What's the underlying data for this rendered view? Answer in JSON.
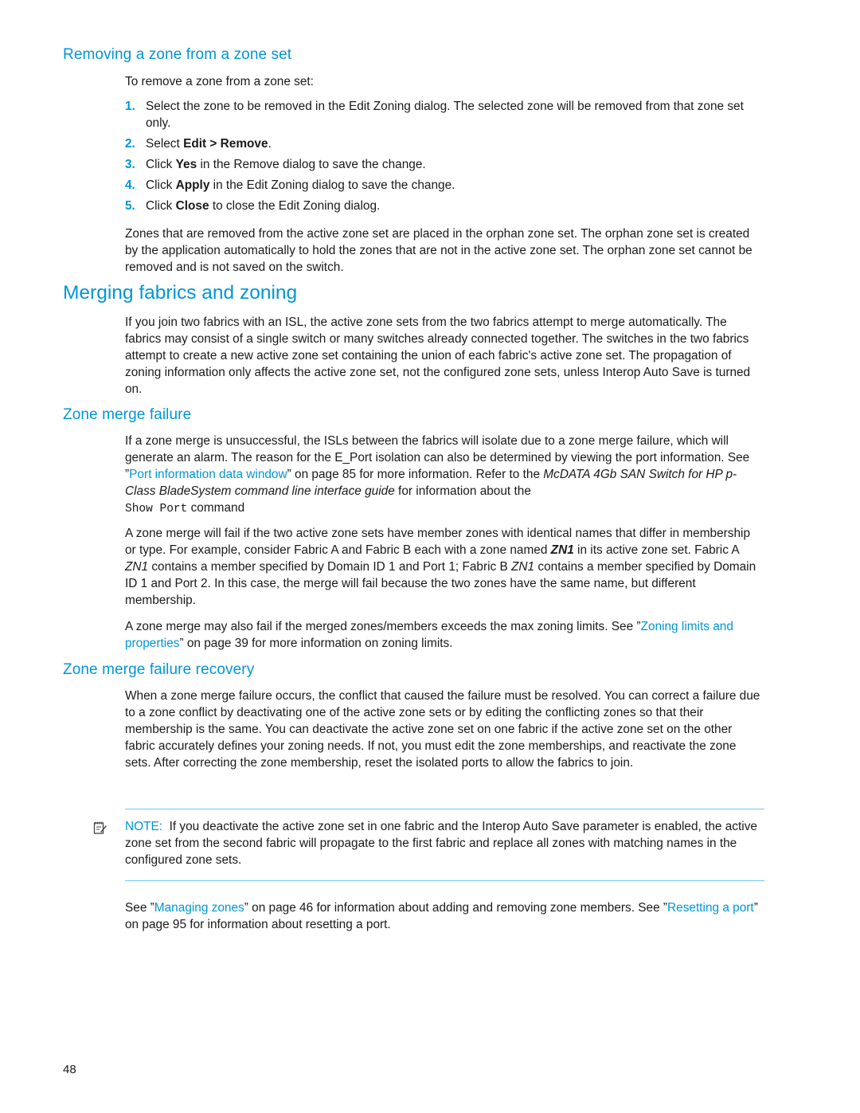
{
  "sections": {
    "removing": {
      "heading": "Removing a zone from a zone set",
      "intro": "To remove a zone from a zone set:",
      "steps": [
        {
          "num": "1.",
          "parts": [
            {
              "t": "Select the zone to be removed in the Edit Zoning dialog. The selected zone will be removed from that zone set only."
            }
          ]
        },
        {
          "num": "2.",
          "parts": [
            {
              "t": "Select "
            },
            {
              "b": "Edit > Remove"
            },
            {
              "t": "."
            }
          ]
        },
        {
          "num": "3.",
          "parts": [
            {
              "t": "Click "
            },
            {
              "b": "Yes"
            },
            {
              "t": " in the Remove dialog to save the change."
            }
          ]
        },
        {
          "num": "4.",
          "parts": [
            {
              "t": "Click "
            },
            {
              "b": "Apply"
            },
            {
              "t": " in the Edit Zoning dialog to save the change."
            }
          ]
        },
        {
          "num": "5.",
          "parts": [
            {
              "t": "Click "
            },
            {
              "b": "Close"
            },
            {
              "t": " to close the Edit Zoning dialog."
            }
          ]
        }
      ],
      "after": "Zones that are removed from the active zone set are placed in the orphan zone set. The orphan zone set is created by the application automatically to hold the zones that are not in the active zone set. The orphan zone set cannot be removed and is not saved on the switch."
    },
    "merging": {
      "heading": "Merging fabrics and zoning",
      "body": "If you join two fabrics with an ISL, the active zone sets from the two fabrics attempt to merge automatically. The fabrics may consist of a single switch or many switches already connected together. The switches in the two fabrics attempt to create a new active zone set containing the union of each fabric's active zone set. The propagation of zoning information only affects the active zone set, not the configured zone sets, unless Interop Auto Save is turned on."
    },
    "failure": {
      "heading": "Zone merge failure",
      "p1": {
        "pre": "If a zone merge is unsuccessful, the ISLs between the fabrics will isolate due to a zone merge failure, which will generate an alarm. The reason for the E_Port isolation can also be determined by viewing the port information. See ”",
        "link": "Port information data window",
        "mid": "” on page 85 for more information. Refer to the ",
        "italic": "McDATA 4Gb SAN Switch for HP p-Class BladeSystem command line interface guide",
        "post": " for information about the ",
        "code": "Show Port",
        "end": " command"
      },
      "p2": {
        "a": "A zone merge will fail if the two active zone sets have member zones with identical names that differ in membership or type. For example, consider Fabric A and Fabric B each with a zone named ",
        "zn_bold": "ZN1",
        "b": " in its active zone set. Fabric A ",
        "zn1": "ZN1",
        "c": " contains a member specified by Domain ID 1 and Port 1; Fabric B ",
        "zn2": "ZN1",
        "d": " contains a member specified by Domain ID 1 and Port 2. In this case, the merge will fail because the two zones have the same name, but different membership."
      },
      "p3": {
        "pre": "A zone merge may also fail if the merged zones/members exceeds the max zoning limits. See ”",
        "link": "Zoning limits and properties",
        "post": "” on page 39 for more information on zoning limits."
      }
    },
    "recovery": {
      "heading": "Zone merge failure recovery",
      "body": "When a zone merge failure occurs, the conflict that caused the failure must be resolved. You can correct a failure due to a zone conflict by deactivating one of the active zone sets or by editing the conflicting zones so that their membership is the same. You can deactivate the active zone set on one fabric if the active zone set on the other fabric accurately defines your zoning needs. If not, you must edit the zone memberships, and reactivate the zone sets. After correcting the zone membership, reset the isolated ports to allow the fabrics to join."
    },
    "note": {
      "icon": "note-icon",
      "label": "NOTE:",
      "text": "If you deactivate the active zone set in one fabric and the Interop Auto Save parameter is enabled, the active zone set from the second fabric will propagate to the first fabric and replace all zones with matching names in the configured zone sets."
    },
    "see_also": {
      "a": "See ”",
      "link1": "Managing zones",
      "b": "” on page 46 for information about adding and removing zone members. See ”",
      "link2": "Resetting a port",
      "c": "” on page 95 for information about resetting a port."
    }
  },
  "page_number": "48",
  "colors": {
    "accent": "#0096d6",
    "rule": "#6ec7ec",
    "text": "#1a1a1a"
  }
}
